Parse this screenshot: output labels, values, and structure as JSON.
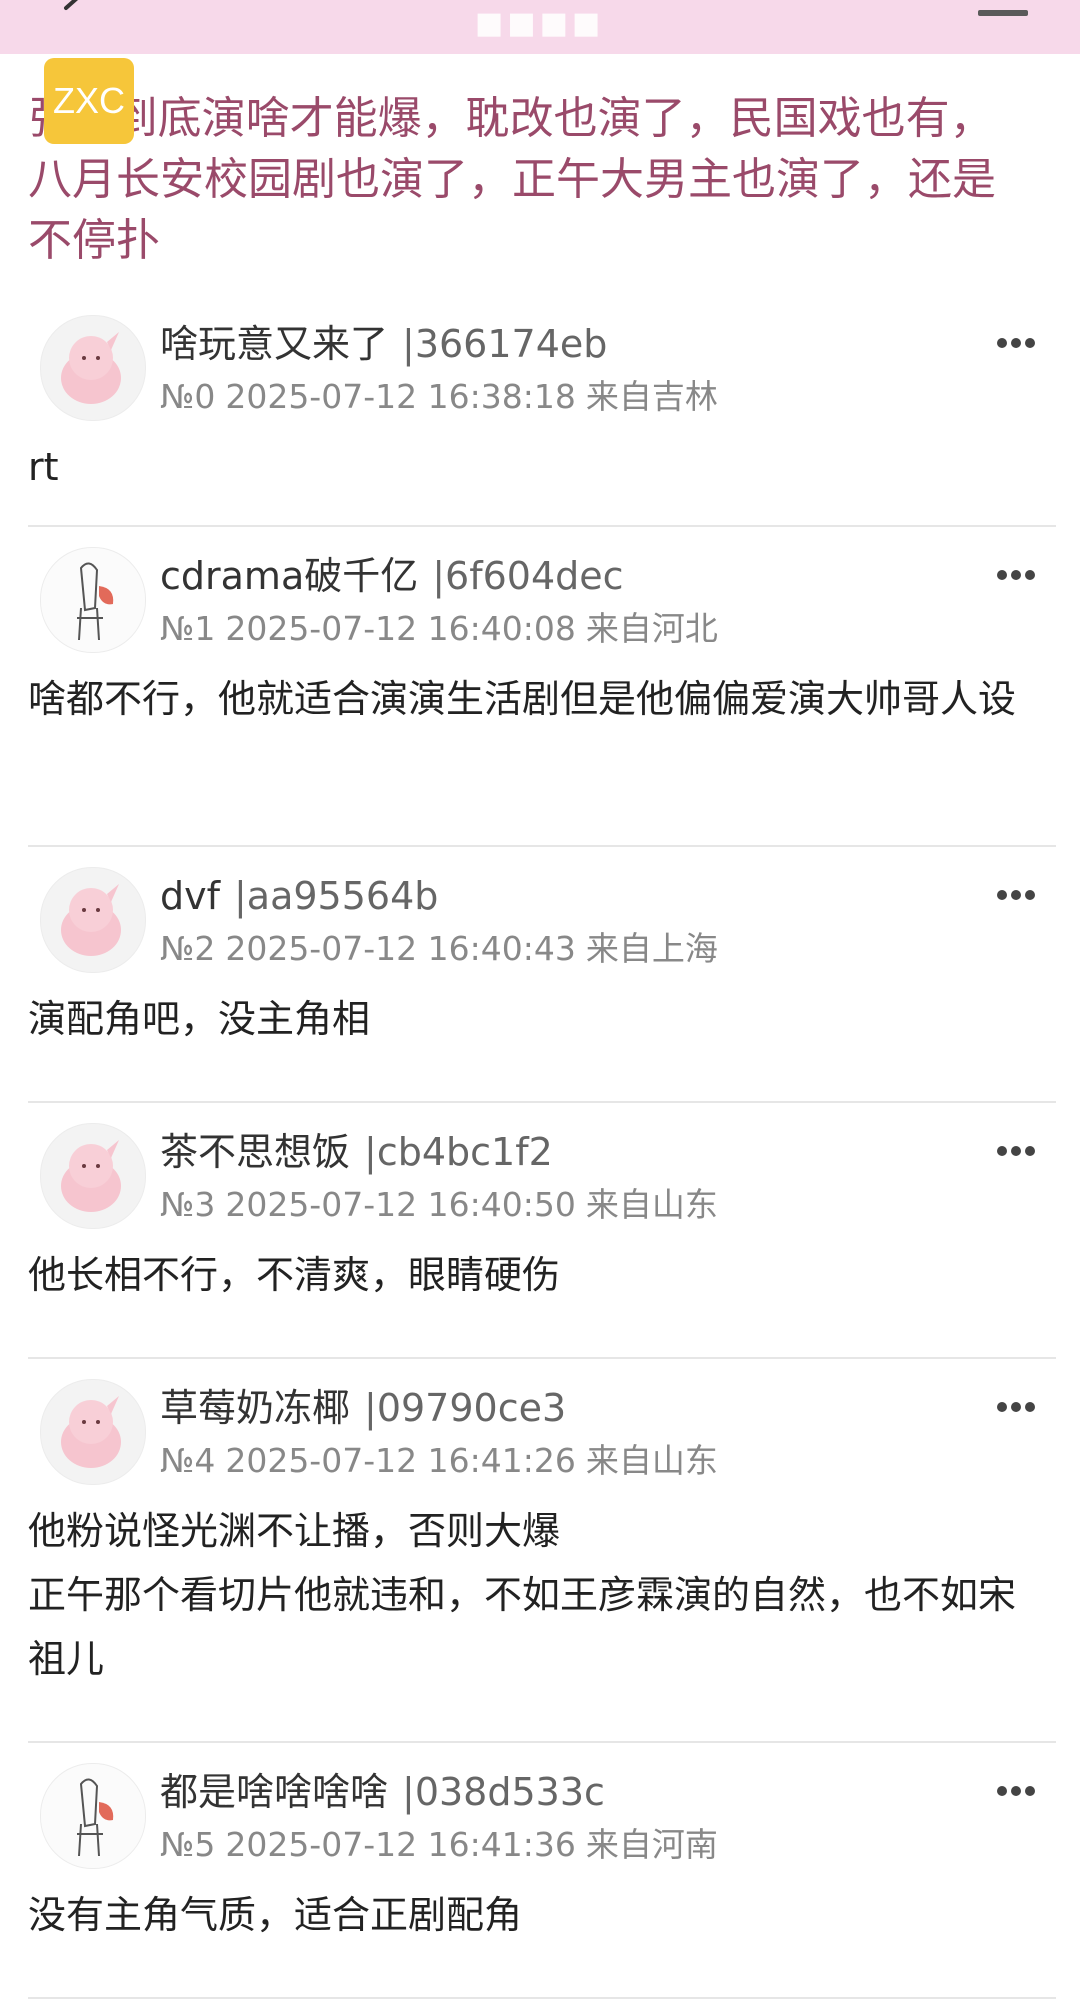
{
  "header": {
    "title": "■■■■",
    "badge": "ZXC",
    "post_title": "张■到底演啥才能爆，耽改也演了，民国戏也有，八月长安校园剧也演了，正午大男主也演了，还是不停扑"
  },
  "colors": {
    "topbar_bg": "#f7d9ea",
    "title_color": "#9a4a6a",
    "badge_bg": "#f6c63a"
  },
  "replies": [
    {
      "name": "啥玩意又来了",
      "uid": "|366174eb",
      "floor": "№0",
      "time": "2025-07-12 16:38:18",
      "location": "来自吉林",
      "content": "rt",
      "avatar": "pink-puff-avatar"
    },
    {
      "name": "cdrama破千亿",
      "uid": "|6f604dec",
      "floor": "№1",
      "time": "2025-07-12 16:40:08",
      "location": "来自河北",
      "content": "啥都不行，他就适合演演生活剧但是他偏偏爱演大帅哥人设",
      "avatar": "sketch-figure-avatar"
    },
    {
      "name": "dvf",
      "uid": "|aa95564b",
      "floor": "№2",
      "time": "2025-07-12 16:40:43",
      "location": "来自上海",
      "content": "演配角吧，没主角相",
      "avatar": "pink-puff-avatar"
    },
    {
      "name": "茶不思想饭",
      "uid": "|cb4bc1f2",
      "floor": "№3",
      "time": "2025-07-12 16:40:50",
      "location": "来自山东",
      "content": "他长相不行，不清爽，眼睛硬伤",
      "avatar": "pink-puff-avatar"
    },
    {
      "name": "草莓奶冻椰",
      "uid": "|09790ce3",
      "floor": "№4",
      "time": "2025-07-12 16:41:26",
      "location": "来自山东",
      "content": "他粉说怪光渊不让播，否则大爆\n正午那个看切片他就违和，不如王彦霖演的自然，也不如宋祖儿",
      "avatar": "pink-puff-avatar"
    },
    {
      "name": "都是啥啥啥啥",
      "uid": "|038d533c",
      "floor": "№5",
      "time": "2025-07-12 16:41:36",
      "location": "来自河南",
      "content": "没有主角气质，适合正剧配角",
      "avatar": "sketch-figure-avatar"
    }
  ]
}
